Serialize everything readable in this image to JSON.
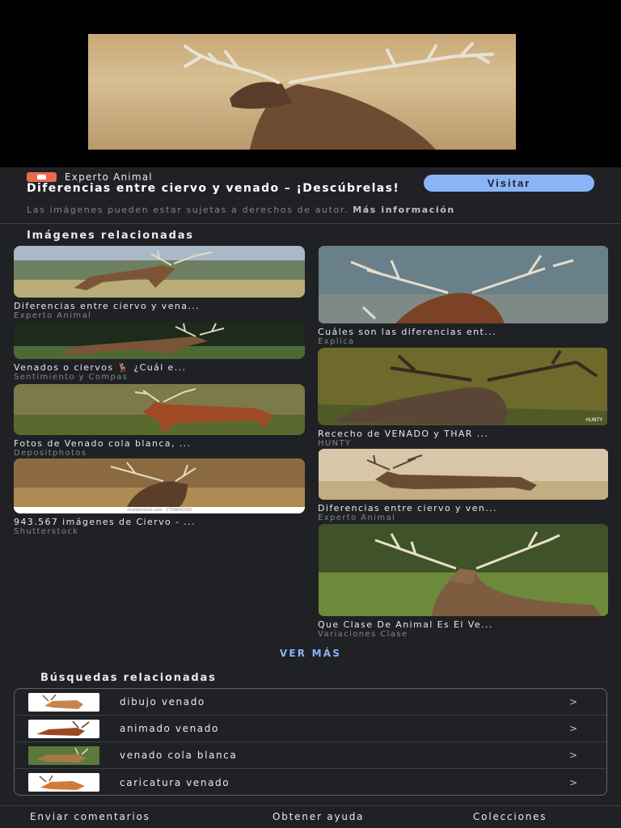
{
  "source": {
    "name": "Experto Animal",
    "icon": "experto-animal-logo"
  },
  "page_title": "Diferencias entre ciervo y venado – ¡Descúbrelas!",
  "visit_label": "Visitar",
  "copyright": {
    "text": "Las imágenes pueden estar sujetas a derechos de autor.",
    "more": "Más información"
  },
  "related": {
    "heading": "Imágenes relacionadas",
    "left": [
      {
        "title": "Diferencias entre ciervo y vena...",
        "source": "Experto Animal"
      },
      {
        "title": "Venados o ciervos 🦌 ¿Cuál e...",
        "source": "Sentimiento y Compas"
      },
      {
        "title": "Fotos de Venado cola blanca, ...",
        "source": "Depositphotos"
      },
      {
        "title": "943.567 imágenes de Ciervo - ...",
        "source": "Shutterstock",
        "watermark": "shutterstock.com · 1709642350"
      }
    ],
    "right": [
      {
        "title": "Cuáles son las diferencias ent...",
        "source": "Explica"
      },
      {
        "title": "Rececho de VENADO y THAR ...",
        "source": "HUNTY",
        "watermark": "HUNTY"
      },
      {
        "title": "Diferencias entre ciervo y ven...",
        "source": "Experto Animal"
      },
      {
        "title": "Que Clase De Animal Es El Ve...",
        "source": "Variaciones Clase"
      }
    ]
  },
  "more_label": "VER MÁS",
  "searches": {
    "heading": "Búsquedas relacionadas",
    "items": [
      {
        "label": "dibujo venado",
        "chevron": ">"
      },
      {
        "label": "animado venado",
        "chevron": ">"
      },
      {
        "label": "venado cola blanca",
        "chevron": ">"
      },
      {
        "label": "caricatura venado",
        "chevron": ">"
      }
    ]
  },
  "footer": {
    "feedback": "Enviar comentarios",
    "help": "Obtener ayuda",
    "collections": "Colecciones"
  }
}
